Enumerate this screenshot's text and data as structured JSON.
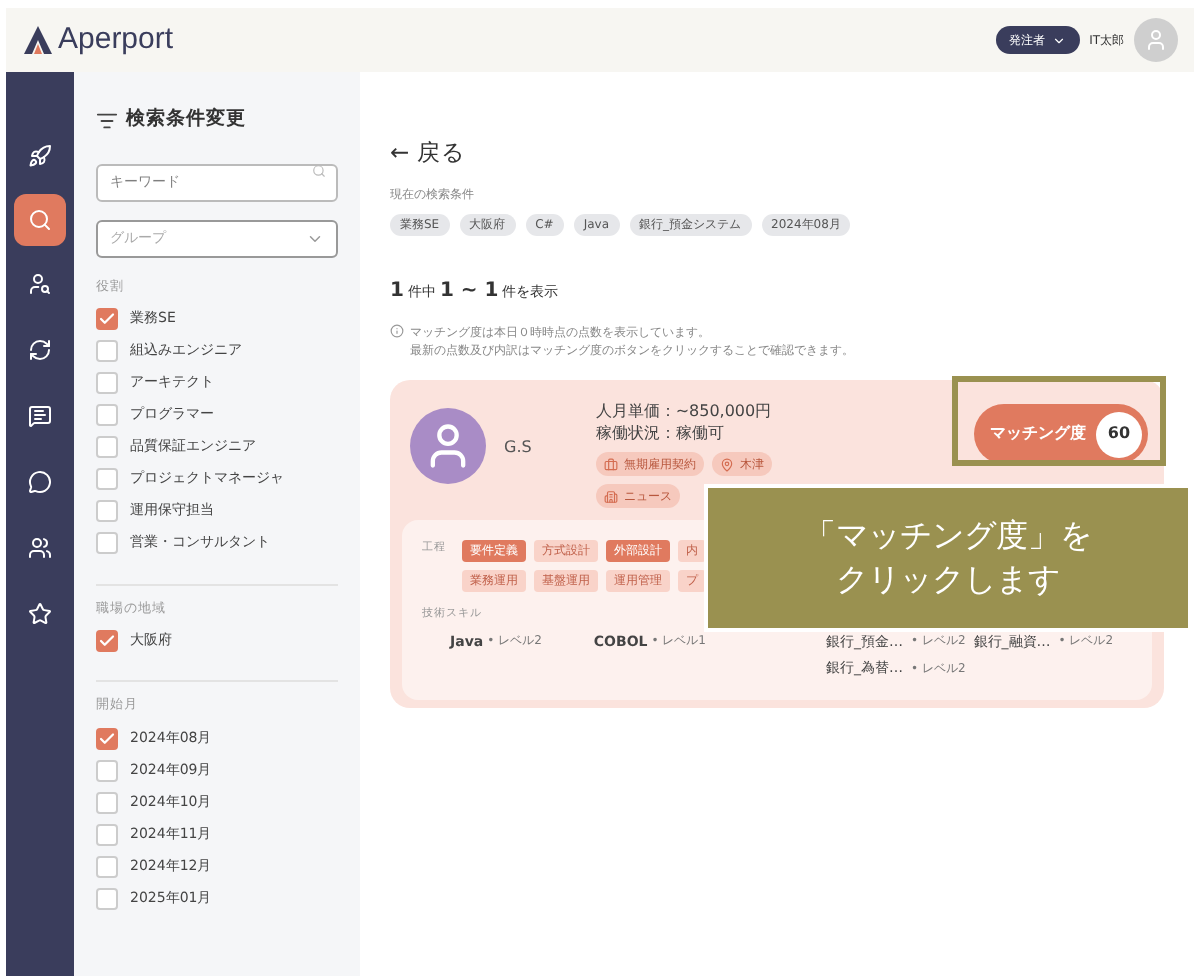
{
  "header": {
    "logo": "Aperport",
    "role_menu": "発注者",
    "user_name": "IT太郎"
  },
  "nav": [
    {
      "selected": false
    },
    {
      "selected": true
    },
    {
      "selected": false
    },
    {
      "selected": false
    },
    {
      "selected": false
    },
    {
      "selected": false
    },
    {
      "selected": false
    },
    {
      "selected": false
    }
  ],
  "filter": {
    "title": "検索条件変更",
    "keyword": {
      "placeholder": "キーワード"
    },
    "group": {
      "placeholder": "グループ"
    },
    "sections": [
      {
        "label": "役割",
        "options": [
          {
            "label": "業務SE",
            "checked": true
          },
          {
            "label": "組込みエンジニア",
            "checked": false
          },
          {
            "label": "アーキテクト",
            "checked": false
          },
          {
            "label": "プログラマー",
            "checked": false
          },
          {
            "label": "品質保証エンジニア",
            "checked": false
          },
          {
            "label": "プロジェクトマネージャ",
            "checked": false
          },
          {
            "label": "運用保守担当",
            "checked": false
          },
          {
            "label": "営業・コンサルタント",
            "checked": false
          }
        ]
      },
      {
        "label": "職場の地域",
        "options": [
          {
            "label": "大阪府",
            "checked": true
          }
        ]
      },
      {
        "label": "開始月",
        "options": [
          {
            "label": "2024年08月",
            "checked": true
          },
          {
            "label": "2024年09月",
            "checked": false
          },
          {
            "label": "2024年10月",
            "checked": false
          },
          {
            "label": "2024年11月",
            "checked": false
          },
          {
            "label": "2024年12月",
            "checked": false
          },
          {
            "label": "2025年01月",
            "checked": false
          }
        ]
      }
    ]
  },
  "main": {
    "back": "← 戻る",
    "conditions_label": "現在の検索条件",
    "conditions": [
      "業務SE",
      "大阪府",
      "C#",
      "Java",
      "銀行_預金システム",
      "2024年08月"
    ],
    "result_count": [
      "1",
      "件中",
      "1 ~ 1",
      "件を表示"
    ],
    "notes": [
      "マッチング度は本日０時時点の点数を表示しています。",
      "最新の点数及び内訳はマッチング度のボタンをクリックすることで確認できます。"
    ],
    "card": {
      "name": "G.S",
      "price": "人月単価：~850,000円",
      "status": "稼働状況：稼働可",
      "tags": [
        "無期雇用契約",
        "木津",
        "ニュース"
      ],
      "matching": {
        "label": "マッチング度",
        "score": "60"
      },
      "process_label": "工程",
      "processes": [
        [
          {
            "label": "要件定義",
            "selected": true
          },
          {
            "label": "方式設計",
            "selected": false
          },
          {
            "label": "外部設計",
            "selected": true
          },
          {
            "label": "内",
            "selected": false
          }
        ],
        [
          {
            "label": "業務運用",
            "selected": false
          },
          {
            "label": "基盤運用",
            "selected": false
          },
          {
            "label": "運用管理",
            "selected": false
          },
          {
            "label": "プ",
            "selected": false
          }
        ]
      ],
      "skills_label": "技術スキル",
      "skills": [
        {
          "name": "Java",
          "level": "• レベル2"
        },
        {
          "name": "COBOL",
          "level": "• レベル1"
        }
      ],
      "domains": [
        {
          "name": "銀行_預金…",
          "level": "• レベル2"
        },
        {
          "name": "銀行_融資…",
          "level": "• レベル2"
        },
        {
          "name": "銀行_為替…",
          "level": "• レベル2"
        }
      ]
    }
  },
  "callout": {
    "text": [
      "「マッチング度」を",
      "クリックします"
    ]
  }
}
